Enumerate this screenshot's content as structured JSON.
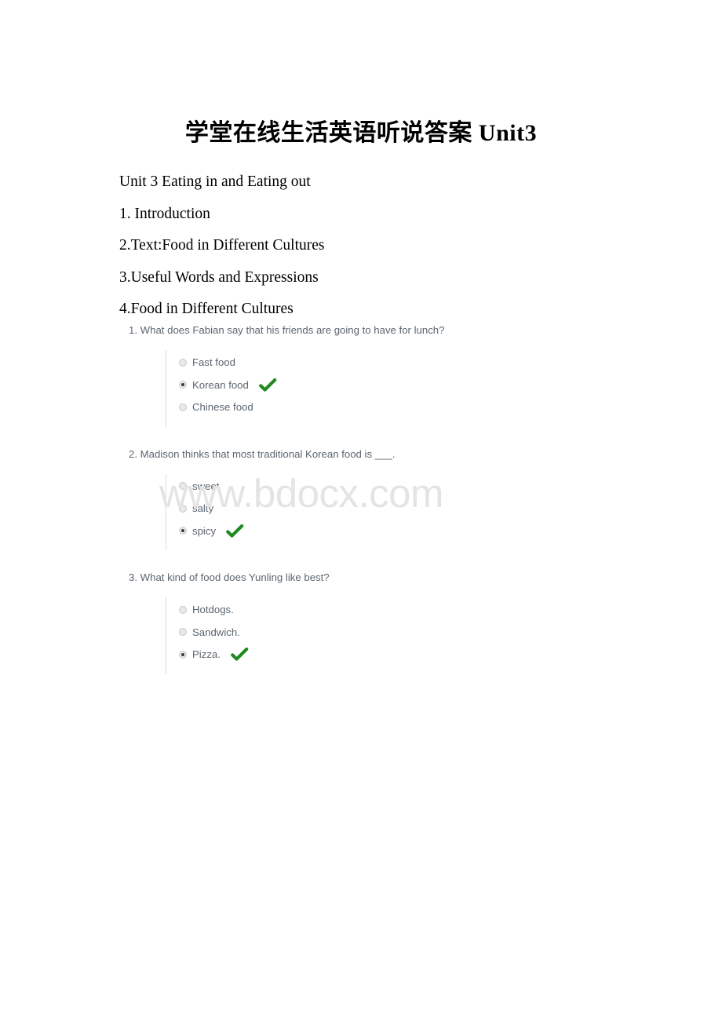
{
  "document": {
    "title": "学堂在线生活英语听说答案 Unit3",
    "body_lines": [
      "Unit 3 Eating in and Eating out",
      "1. Introduction",
      "2.Text:Food in Different Cultures",
      "3.Useful Words and Expressions",
      "4.Food in Different Cultures"
    ]
  },
  "watermark": {
    "text": "www.bdocx.com",
    "color": "#e4e4e4"
  },
  "colors": {
    "question_text": "#5c6670",
    "option_text": "#5c6670",
    "correct_check": "#1f8a1f",
    "radio_fill": "#e9e9e9",
    "radio_border": "#c8c8c8",
    "radio_dot": "#3a3a3a",
    "divider_line": "#dcdcdc"
  },
  "quiz": {
    "questions": [
      {
        "number": "1.",
        "text": "1. What does Fabian say that his friends are going to have for lunch?",
        "options": [
          {
            "label": "Fast food",
            "selected": false,
            "correct": false
          },
          {
            "label": "Korean food",
            "selected": true,
            "correct": true
          },
          {
            "label": "Chinese food",
            "selected": false,
            "correct": false
          }
        ]
      },
      {
        "number": "2.",
        "text": "2. Madison thinks that most traditional Korean food is ___.",
        "options": [
          {
            "label": "sweet",
            "selected": false,
            "correct": false
          },
          {
            "label": "salty",
            "selected": false,
            "correct": false
          },
          {
            "label": "spicy",
            "selected": true,
            "correct": true
          }
        ]
      },
      {
        "number": "3.",
        "text": "3. What kind of food does Yunling like best?",
        "options": [
          {
            "label": "Hotdogs.",
            "selected": false,
            "correct": false
          },
          {
            "label": "Sandwich.",
            "selected": false,
            "correct": false
          },
          {
            "label": "Pizza.",
            "selected": true,
            "correct": true
          }
        ]
      }
    ]
  }
}
